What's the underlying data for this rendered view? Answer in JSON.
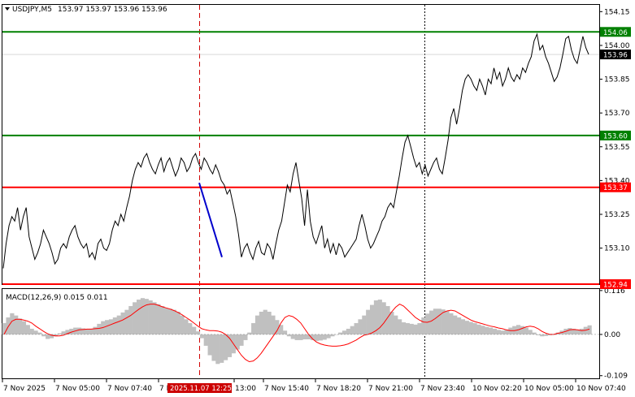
{
  "header": {
    "symbol": "USDJPY,M5",
    "ohlc": "153.97 153.97 153.96 153.96"
  },
  "colors": {
    "price_line": "#000000",
    "green_level": "#008000",
    "red_level": "#ff0000",
    "histogram": "#c0c0c0",
    "signal": "#ff0000",
    "trend": "#0000cc",
    "current_price_bg": "#000000"
  },
  "price_axis": {
    "ticks": [
      "154.15",
      "154.00",
      "153.85",
      "153.70",
      "153.55",
      "153.40",
      "153.25",
      "153.10"
    ],
    "range": [
      152.94,
      154.18
    ]
  },
  "levels": [
    {
      "label": "154.06",
      "value": 154.06,
      "color": "#008000"
    },
    {
      "label": "153.60",
      "value": 153.6,
      "color": "#008000"
    },
    {
      "label": "153.37",
      "value": 153.37,
      "color": "#ff0000"
    },
    {
      "label": "152.94",
      "value": 152.94,
      "color": "#ff0000"
    }
  ],
  "current_price": {
    "label": "153.96",
    "value": 153.96
  },
  "macd": {
    "label": "MACD(12,26,9) 0.015 0.011",
    "ticks": [
      "0.116",
      "0.00",
      "-0.109"
    ],
    "range": [
      -0.116,
      0.12
    ]
  },
  "time_axis": {
    "labels": [
      "7 Nov 2025",
      "7 Nov 05:00",
      "7 Nov 07:40",
      "7 Nov 10:20",
      "13:00",
      "7 Nov 15:40",
      "7 Nov 18:20",
      "7 Nov 21:00",
      "7 Nov 23:40",
      "10 Nov 02:20",
      "10 Nov 05:00",
      "10 Nov 07:40"
    ],
    "highlight_label": "2025.11.07 12:25"
  },
  "chart_data": {
    "type": "line",
    "series": [
      {
        "values": [
          153.01,
          153.12,
          153.2,
          153.24,
          153.22,
          153.28,
          153.18,
          153.24,
          153.28,
          153.15,
          153.1,
          153.05,
          153.08,
          153.12,
          153.18,
          153.15,
          153.12,
          153.08,
          153.03,
          153.05,
          153.1,
          153.12,
          153.1,
          153.15,
          153.18,
          153.2,
          153.15,
          153.12,
          153.1,
          153.12,
          153.06,
          153.08,
          153.05,
          153.12,
          153.14,
          153.1,
          153.09,
          153.12,
          153.18,
          153.22,
          153.2,
          153.25,
          153.22,
          153.28,
          153.33,
          153.4,
          153.45,
          153.48,
          153.46,
          153.5,
          153.52,
          153.48,
          153.45,
          153.43,
          153.47,
          153.5,
          153.44,
          153.48,
          153.5,
          153.46,
          153.42,
          153.45,
          153.5,
          153.48,
          153.44,
          153.46,
          153.5,
          153.52,
          153.48,
          153.45,
          153.5,
          153.48,
          153.45,
          153.43,
          153.47,
          153.44,
          153.4,
          153.38,
          153.34,
          153.36,
          153.3,
          153.24,
          153.16,
          153.06,
          153.1,
          153.12,
          153.08,
          153.05,
          153.1,
          153.13,
          153.08,
          153.07,
          153.12,
          153.1,
          153.05,
          153.12,
          153.18,
          153.22,
          153.3,
          153.38,
          153.35,
          153.43,
          153.48,
          153.4,
          153.32,
          153.2,
          153.36,
          153.22,
          153.15,
          153.12,
          153.16,
          153.2,
          153.1,
          153.14,
          153.08,
          153.12,
          153.07,
          153.12,
          153.1,
          153.06,
          153.08,
          153.1,
          153.12,
          153.14,
          153.2,
          153.25,
          153.2,
          153.14,
          153.1,
          153.12,
          153.15,
          153.18,
          153.22,
          153.24,
          153.28,
          153.3,
          153.28,
          153.35,
          153.42,
          153.5,
          153.57,
          153.6,
          153.55,
          153.5,
          153.46,
          153.48,
          153.43,
          153.47,
          153.42,
          153.45,
          153.48,
          153.5,
          153.45,
          153.43,
          153.5,
          153.58,
          153.68,
          153.72,
          153.65,
          153.72,
          153.8,
          153.85,
          153.87,
          153.85,
          153.82,
          153.8,
          153.85,
          153.82,
          153.78,
          153.85,
          153.83,
          153.9,
          153.85,
          153.88,
          153.82,
          153.85,
          153.9,
          153.86,
          153.84,
          153.87,
          153.85,
          153.9,
          153.88,
          153.92,
          153.95,
          154.02,
          154.05,
          153.98,
          154.0,
          153.95,
          153.92,
          153.88,
          153.84,
          153.86,
          153.9,
          153.96,
          154.03,
          154.04,
          153.98,
          153.94,
          153.92,
          153.98,
          154.04,
          153.99,
          153.96
        ]
      }
    ],
    "macd_histogram": [
      0.03,
      0.045,
      0.056,
      0.05,
      0.042,
      0.035,
      0.025,
      0.015,
      0.01,
      0.005,
      -0.005,
      -0.012,
      -0.01,
      -0.005,
      0.003,
      0.008,
      0.012,
      0.015,
      0.018,
      0.018,
      0.016,
      0.014,
      0.015,
      0.02,
      0.028,
      0.035,
      0.038,
      0.04,
      0.045,
      0.05,
      0.058,
      0.065,
      0.075,
      0.085,
      0.092,
      0.096,
      0.094,
      0.09,
      0.085,
      0.08,
      0.075,
      0.07,
      0.068,
      0.065,
      0.06,
      0.05,
      0.04,
      0.03,
      0.02,
      0.008,
      -0.01,
      -0.03,
      -0.055,
      -0.07,
      -0.078,
      -0.075,
      -0.068,
      -0.06,
      -0.05,
      -0.04,
      -0.03,
      -0.015,
      0.005,
      0.03,
      0.05,
      0.06,
      0.065,
      0.06,
      0.05,
      0.038,
      0.025,
      0.01,
      -0.005,
      -0.012,
      -0.015,
      -0.015,
      -0.013,
      -0.013,
      -0.015,
      -0.017,
      -0.016,
      -0.014,
      -0.01,
      -0.005,
      0.0,
      0.005,
      0.01,
      0.015,
      0.022,
      0.03,
      0.04,
      0.05,
      0.065,
      0.078,
      0.09,
      0.092,
      0.085,
      0.075,
      0.06,
      0.05,
      0.04,
      0.032,
      0.03,
      0.028,
      0.026,
      0.03,
      0.045,
      0.055,
      0.063,
      0.068,
      0.068,
      0.066,
      0.062,
      0.056,
      0.05,
      0.045,
      0.04,
      0.036,
      0.033,
      0.03,
      0.026,
      0.023,
      0.02,
      0.018,
      0.015,
      0.012,
      0.01,
      0.012,
      0.018,
      0.022,
      0.025,
      0.022,
      0.018,
      0.012,
      0.005,
      -0.002,
      -0.005,
      -0.004,
      -0.002,
      0.0,
      0.005,
      0.01,
      0.015,
      0.017,
      0.015,
      0.012,
      0.015,
      0.02,
      0.024
    ],
    "macd_signal": [
      0.0,
      0.02,
      0.035,
      0.04,
      0.04,
      0.038,
      0.035,
      0.03,
      0.022,
      0.015,
      0.008,
      0.002,
      -0.002,
      -0.004,
      -0.004,
      -0.002,
      0.002,
      0.006,
      0.009,
      0.012,
      0.013,
      0.014,
      0.014,
      0.015,
      0.016,
      0.018,
      0.022,
      0.026,
      0.03,
      0.034,
      0.038,
      0.044,
      0.05,
      0.058,
      0.066,
      0.073,
      0.078,
      0.08,
      0.08,
      0.077,
      0.073,
      0.07,
      0.067,
      0.063,
      0.058,
      0.052,
      0.045,
      0.038,
      0.03,
      0.022,
      0.015,
      0.012,
      0.01,
      0.01,
      0.009,
      0.006,
      0.0,
      -0.01,
      -0.025,
      -0.04,
      -0.055,
      -0.066,
      -0.072,
      -0.07,
      -0.062,
      -0.05,
      -0.035,
      -0.02,
      -0.005,
      0.01,
      0.03,
      0.045,
      0.05,
      0.047,
      0.04,
      0.03,
      0.015,
      0.0,
      -0.012,
      -0.02,
      -0.025,
      -0.028,
      -0.03,
      -0.031,
      -0.031,
      -0.03,
      -0.028,
      -0.025,
      -0.02,
      -0.015,
      -0.008,
      -0.002,
      0.0,
      0.004,
      0.01,
      0.018,
      0.03,
      0.045,
      0.06,
      0.072,
      0.08,
      0.075,
      0.065,
      0.055,
      0.045,
      0.038,
      0.033,
      0.032,
      0.035,
      0.042,
      0.05,
      0.058,
      0.062,
      0.064,
      0.062,
      0.056,
      0.05,
      0.044,
      0.038,
      0.034,
      0.031,
      0.028,
      0.025,
      0.022,
      0.02,
      0.017,
      0.015,
      0.012,
      0.01,
      0.01,
      0.012,
      0.016,
      0.02,
      0.022,
      0.02,
      0.015,
      0.008,
      0.003,
      0.0,
      0.0,
      0.003,
      0.005,
      0.008,
      0.012,
      0.013,
      0.012,
      0.01,
      0.011,
      0.014
    ]
  }
}
